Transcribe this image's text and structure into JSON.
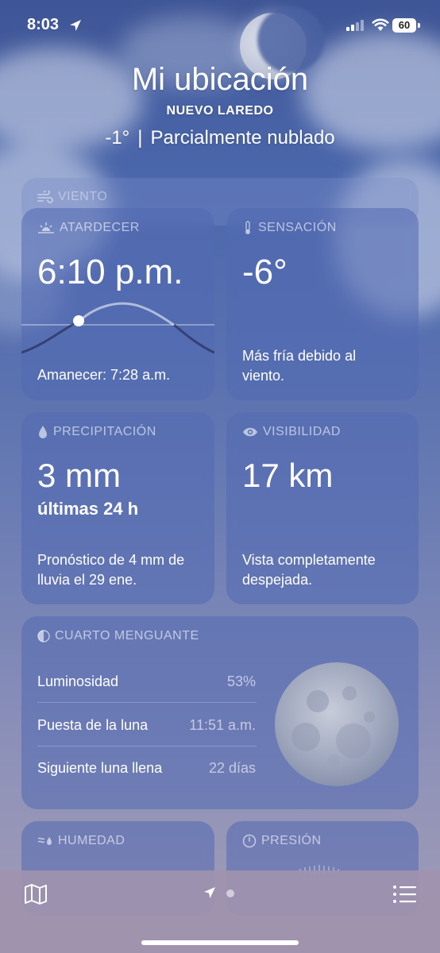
{
  "status_bar": {
    "time": "8:03",
    "battery": "60"
  },
  "header": {
    "title": "Mi ubicación",
    "city": "NUEVO LAREDO",
    "temperature": "-1°",
    "separator": "|",
    "condition": "Parcialmente nublado"
  },
  "wind_card": {
    "label": "VIENTO"
  },
  "sunset_card": {
    "label": "ATARDECER",
    "time": "6:10 p.m.",
    "sunrise": "Amanecer: 7:28 a.m."
  },
  "feels_card": {
    "label": "SENSACIÓN",
    "value": "-6°",
    "note": "Más fría debido al viento."
  },
  "precip_card": {
    "label": "PRECIPITACIÓN",
    "value": "3 mm",
    "period": "últimas 24 h",
    "forecast": "Pronóstico de 4 mm de lluvia el 29 ene."
  },
  "visibility_card": {
    "label": "VISIBILIDAD",
    "value": "17 km",
    "note": "Vista completamente despejada."
  },
  "moon_card": {
    "label": "CUARTO MENGUANTE",
    "rows": [
      {
        "label": "Luminosidad",
        "value": "53%"
      },
      {
        "label": "Puesta de la luna",
        "value": "11:51 a.m."
      },
      {
        "label": "Siguiente luna llena",
        "value": "22 días"
      }
    ]
  },
  "humidity_card": {
    "label": "HUMEDAD"
  },
  "pressure_card": {
    "label": "PRESIÓN"
  },
  "toolbar": {
    "icons": [
      "map-icon",
      "location-arrow-icon",
      "page-dot-icon",
      "list-icon"
    ]
  }
}
